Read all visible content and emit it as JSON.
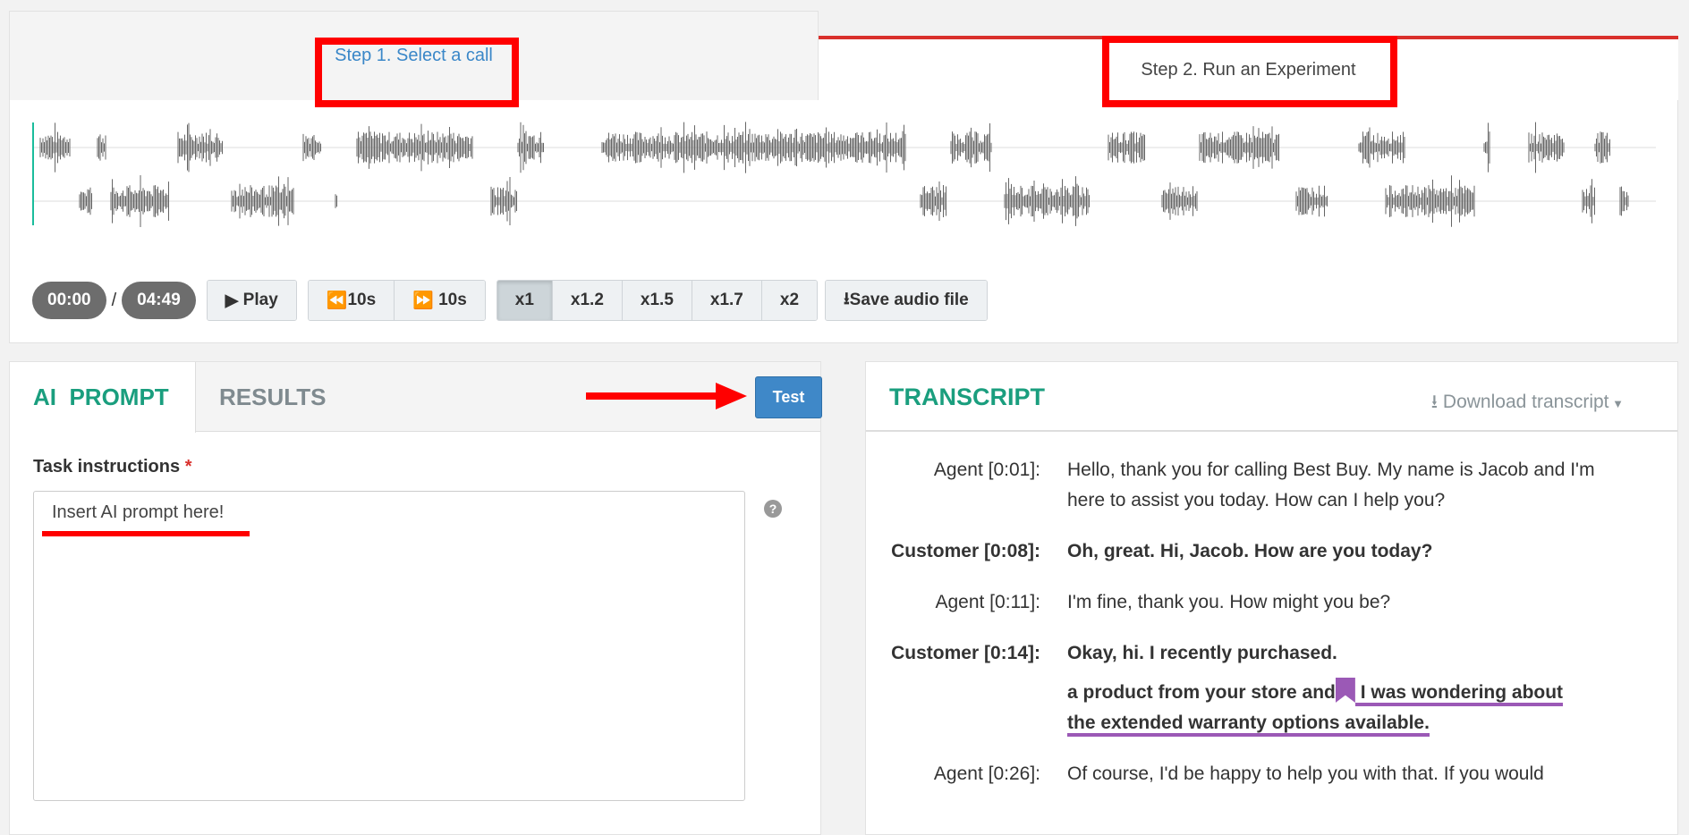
{
  "steps": {
    "step1": "Step 1. Select a call",
    "step2": "Step 2. Run an Experiment"
  },
  "player": {
    "current": "00:00",
    "separator": "/",
    "duration": "04:49",
    "play": "Play",
    "back": "10s",
    "forward": "10s",
    "speeds": [
      "x1",
      "x1.2",
      "x1.5",
      "x1.7",
      "x2"
    ],
    "active_speed": "x1",
    "save": "Save audio file"
  },
  "left": {
    "tab_prompt": "AI  PROMPT",
    "tab_results": "RESULTS",
    "test": "Test",
    "label": "Task instructions",
    "required": "*",
    "textarea": "Insert AI prompt here!"
  },
  "transcript": {
    "title": "TRANSCRIPT",
    "download": "Download transcript",
    "rows": [
      {
        "speaker": "Agent [0:01]:",
        "text": "Hello, thank you for calling Best Buy. My name is Jacob and I'm here to assist you today. How can I help you?"
      },
      {
        "speaker": "Customer [0:08]:",
        "text": "Oh, great. Hi, Jacob. How are you today?"
      },
      {
        "speaker": "Agent [0:11]:",
        "text": "I'm fine, thank you. How might you be?"
      },
      {
        "speaker": "Customer [0:14]:",
        "text": "Okay, hi. I recently purchased.",
        "cont": "a product from your store and",
        "highlight1": " I was wondering about",
        "highlight2": "the extended warranty options available."
      },
      {
        "speaker": "Agent [0:26]:",
        "text": "Of course, I'd be happy to help you with that. If you would"
      }
    ]
  },
  "colors": {
    "accent": "#1a9e7e",
    "link": "#3a87c8",
    "button": "#3f88c8",
    "annotation": "#ff0000",
    "highlight": "#9b59b6"
  }
}
